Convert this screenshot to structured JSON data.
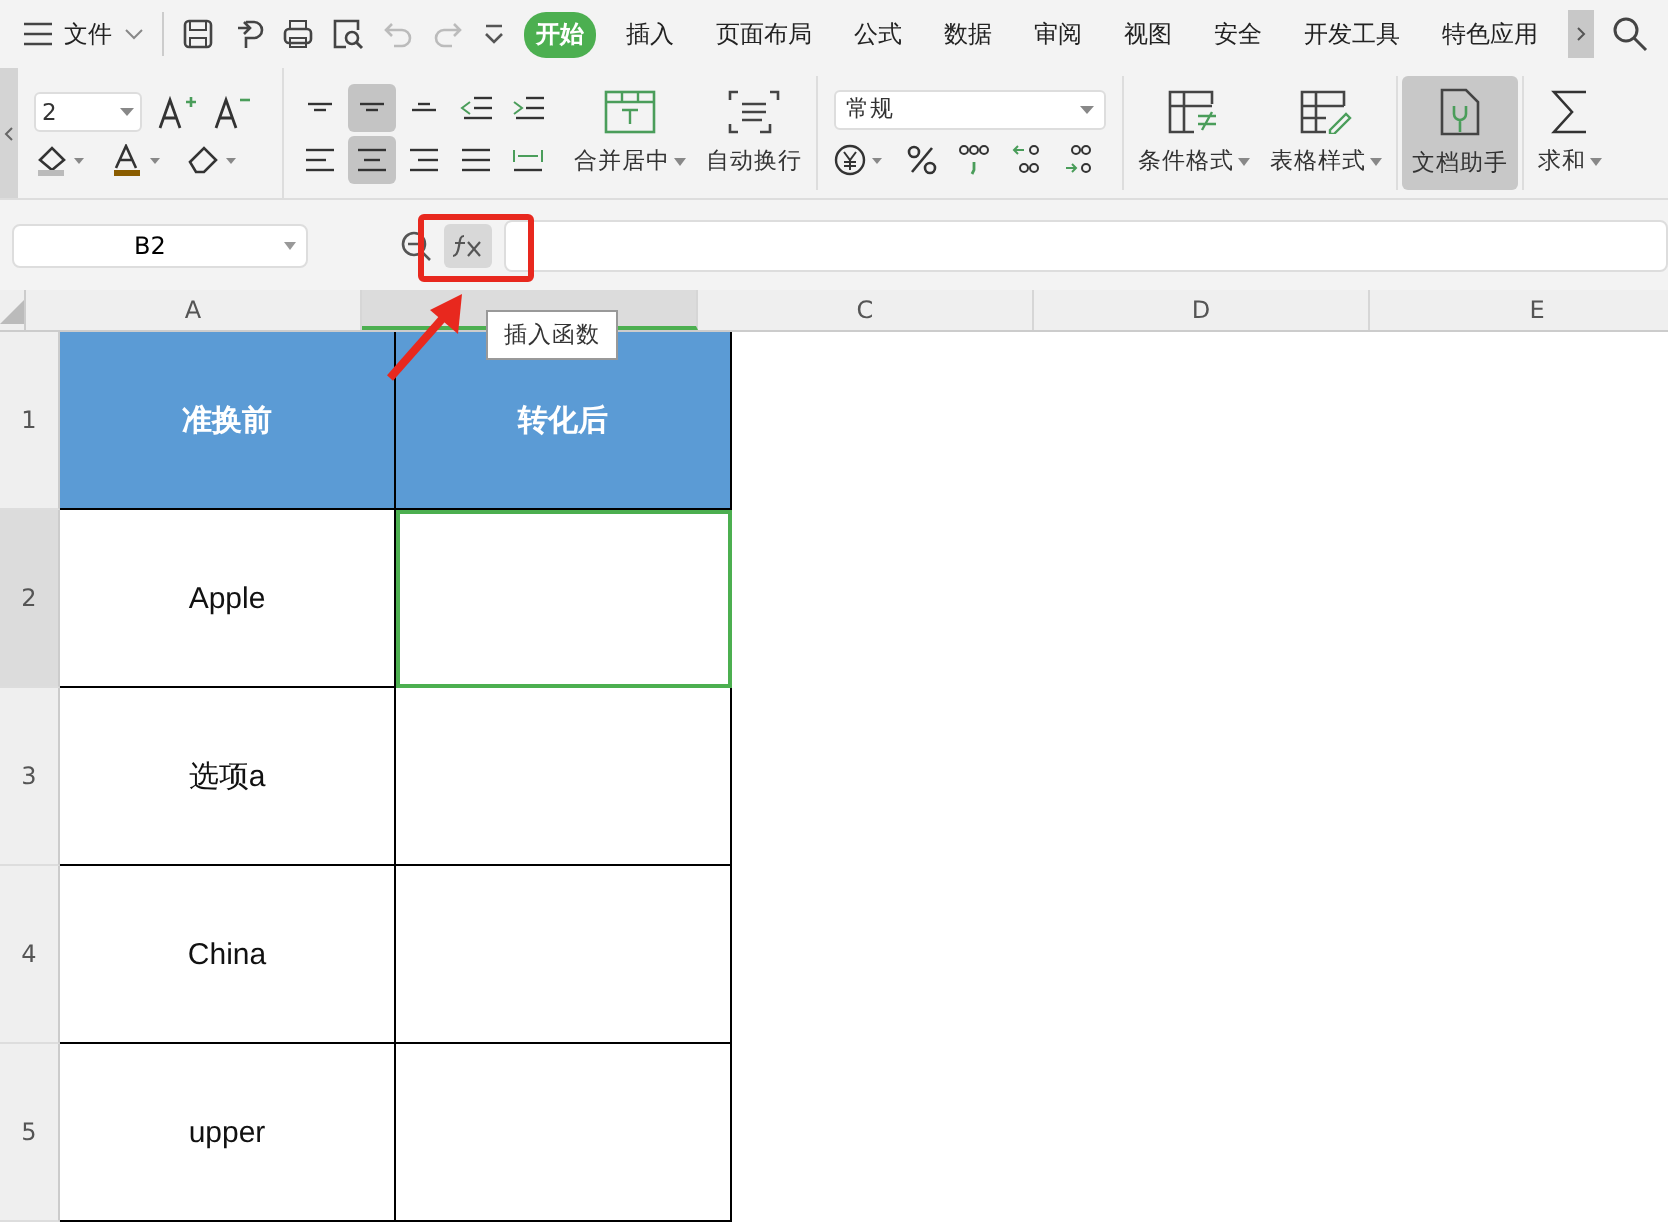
{
  "menu": {
    "label": "文件"
  },
  "tabs": [
    {
      "label": "开始",
      "selected": true
    },
    {
      "label": "插入",
      "selected": false
    },
    {
      "label": "页面布局",
      "selected": false
    },
    {
      "label": "公式",
      "selected": false
    },
    {
      "label": "数据",
      "selected": false
    },
    {
      "label": "审阅",
      "selected": false
    },
    {
      "label": "视图",
      "selected": false
    },
    {
      "label": "安全",
      "selected": false
    },
    {
      "label": "开发工具",
      "selected": false
    },
    {
      "label": "特色应用",
      "selected": false
    }
  ],
  "ribbon": {
    "font_size": "2",
    "number_format": "常规",
    "align": [
      {
        "kind": "top",
        "selected": false
      },
      {
        "kind": "middle",
        "selected": true
      },
      {
        "kind": "bottom",
        "selected": false
      },
      {
        "kind": "outdent",
        "selected": false
      },
      {
        "kind": "indent",
        "selected": false
      },
      {
        "kind": "left",
        "selected": false
      },
      {
        "kind": "center",
        "selected": true
      },
      {
        "kind": "right",
        "selected": false
      },
      {
        "kind": "justify",
        "selected": false
      },
      {
        "kind": "distribute",
        "selected": false
      }
    ],
    "buttons": [
      {
        "kind": "merge",
        "label": "合并居中",
        "dropdown": true,
        "selected": false
      },
      {
        "kind": "wrap",
        "label": "自动换行",
        "dropdown": false,
        "selected": false
      },
      {
        "kind": "cond",
        "label": "条件格式",
        "dropdown": true,
        "selected": false
      },
      {
        "kind": "table",
        "label": "表格样式",
        "dropdown": true,
        "selected": false
      },
      {
        "kind": "assistant",
        "label": "文档助手",
        "dropdown": false,
        "selected": true
      },
      {
        "kind": "sum",
        "label": "求和",
        "dropdown": true,
        "selected": false
      }
    ]
  },
  "name_box": "B2",
  "tooltip": "插入函数",
  "columns": [
    {
      "label": "A",
      "selected": false
    },
    {
      "selected": true
    },
    {
      "label": "C",
      "selected": false
    },
    {
      "label": "D",
      "selected": false
    },
    {
      "label": "E",
      "selected": false
    }
  ],
  "rows": [
    {
      "number": "1",
      "kind": "header",
      "selected": false,
      "cells": [
        {
          "text": "准换前",
          "selected": false
        },
        {
          "text": "转化后",
          "selected": false
        }
      ]
    },
    {
      "number": "2",
      "kind": "data",
      "selected": true,
      "cells": [
        {
          "text": "Apple",
          "selected": false
        },
        {
          "selected": true
        }
      ]
    },
    {
      "number": "3",
      "kind": "data",
      "selected": false,
      "cells": [
        {
          "text": "选项a",
          "selected": false
        },
        {
          "selected": false
        }
      ]
    },
    {
      "number": "4",
      "kind": "data",
      "selected": false,
      "cells": [
        {
          "text": "China",
          "selected": false
        },
        {
          "selected": false
        }
      ]
    },
    {
      "number": "5",
      "kind": "data",
      "selected": false,
      "cells": [
        {
          "text": "upper",
          "selected": false
        },
        {
          "selected": false
        }
      ]
    }
  ]
}
